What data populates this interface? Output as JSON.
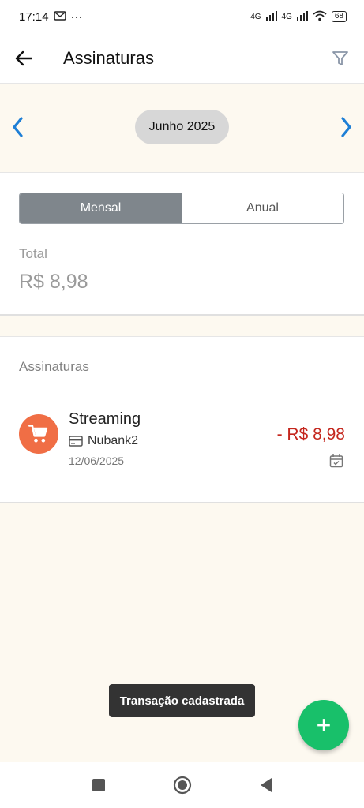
{
  "status_bar": {
    "time": "17:14",
    "dots": "···",
    "network": "4G",
    "battery": "68"
  },
  "app_bar": {
    "title": "Assinaturas"
  },
  "month_selector": {
    "current_month": "Junho 2025",
    "prev_arrow": "‹",
    "next_arrow": "›"
  },
  "period_toggle": {
    "options": [
      "Mensal",
      "Anual"
    ],
    "selected": "Mensal"
  },
  "summary": {
    "total_label": "Total",
    "total_value": "R$ 8,98"
  },
  "subscriptions": {
    "section_title": "Assinaturas",
    "items": [
      {
        "name": "Streaming",
        "account": "Nubank2",
        "date": "12/06/2025",
        "amount": "- R$ 8,98",
        "icon": "cart-icon"
      }
    ]
  },
  "toast": {
    "message": "Transação cadastrada"
  },
  "fab": {
    "label": "+"
  },
  "colors": {
    "accent_blue": "#1e7fd6",
    "avatar_orange": "#f06e45",
    "expense_red": "#c4261d",
    "fab_green": "#18c06a",
    "toggle_active": "#7f868c",
    "background": "#fdf9f0"
  }
}
